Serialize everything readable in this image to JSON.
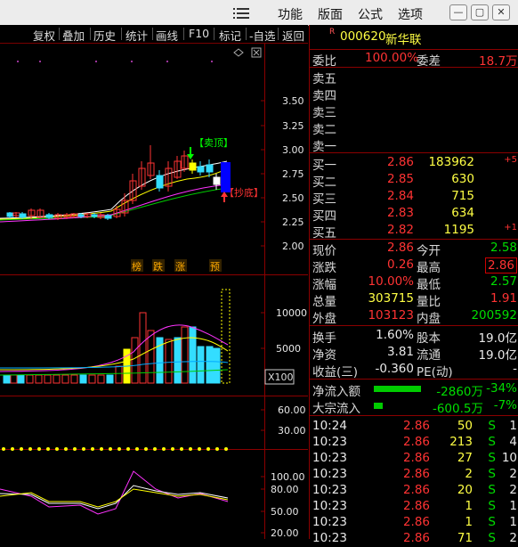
{
  "menu": {
    "items": [
      "功能",
      "版面",
      "公式",
      "选项"
    ],
    "hamburger_icon": "hamburger-menu-icon"
  },
  "window_buttons": {
    "minimize": "—",
    "restore": "▢",
    "close": "✕"
  },
  "toolbar": {
    "items": [
      "复权",
      "叠加",
      "历史",
      "统计",
      "画线",
      "F10",
      "标记",
      "-自选",
      "返回"
    ]
  },
  "main_chart": {
    "y_ticks": [
      "3.50",
      "3.25",
      "3.00",
      "2.75",
      "2.50",
      "2.25",
      "2.00"
    ],
    "annotations": {
      "top": "【卖顶】",
      "bottom": "【抄底】"
    },
    "legend_tags": [
      "榜",
      "跌",
      "涨",
      "预"
    ],
    "colors": {
      "up": "#ff3333",
      "down": "#33ddff",
      "ma1": "#ffffff",
      "ma2": "#ffff00",
      "ma3": "#ff33ff",
      "ma4": "#00cc00"
    }
  },
  "volume_chart": {
    "y_ticks": [
      "10000",
      "5000"
    ],
    "unit": "X100"
  },
  "osc1_chart": {
    "y_ticks": [
      "60.00",
      "30.00"
    ]
  },
  "osc2_chart": {
    "y_ticks": [
      "100.00",
      "80.00",
      "50.00",
      "20.00"
    ]
  },
  "stock": {
    "code": "000620",
    "name": "新华联",
    "badge": "R"
  },
  "weibi": {
    "label": "委比",
    "value": "100.00%",
    "label2": "委差",
    "value2": "18.7万"
  },
  "asks": [
    {
      "label": "卖五",
      "price": "",
      "vol": ""
    },
    {
      "label": "卖四",
      "price": "",
      "vol": ""
    },
    {
      "label": "卖三",
      "price": "",
      "vol": ""
    },
    {
      "label": "卖二",
      "price": "",
      "vol": ""
    },
    {
      "label": "卖一",
      "price": "",
      "vol": ""
    }
  ],
  "bids": [
    {
      "label": "买一",
      "price": "2.86",
      "vol": "183962",
      "chg": "+5"
    },
    {
      "label": "买二",
      "price": "2.85",
      "vol": "630",
      "chg": ""
    },
    {
      "label": "买三",
      "price": "2.84",
      "vol": "715",
      "chg": ""
    },
    {
      "label": "买四",
      "price": "2.83",
      "vol": "634",
      "chg": ""
    },
    {
      "label": "买五",
      "price": "2.82",
      "vol": "1195",
      "chg": "+1"
    }
  ],
  "quote_stats": [
    {
      "l1": "现价",
      "v1": "2.86",
      "l2": "今开",
      "v2": "2.58"
    },
    {
      "l1": "涨跌",
      "v1": "0.26",
      "l2": "最高",
      "v2": "2.86"
    },
    {
      "l1": "涨幅",
      "v1": "10.00%",
      "l2": "最低",
      "v2": "2.57"
    },
    {
      "l1": "总量",
      "v1": "303715",
      "l2": "量比",
      "v2": "1.91"
    },
    {
      "l1": "外盘",
      "v1": "103123",
      "l2": "内盘",
      "v2": "200592"
    }
  ],
  "fundamentals": [
    {
      "l1": "换手",
      "v1": "1.60%",
      "l2": "股本",
      "v2": "19.0亿"
    },
    {
      "l1": "净资",
      "v1": "3.81",
      "l2": "流通",
      "v2": "19.0亿"
    },
    {
      "l1": "收益(三)",
      "v1": "-0.360",
      "l2": "PE(动)",
      "v2": "-"
    }
  ],
  "flows": [
    {
      "label": "净流入额",
      "value": "-2860万",
      "pct": "-34%",
      "bar_fraction": 0.95
    },
    {
      "label": "大宗流入",
      "value": "-600.5万",
      "pct": "-7%",
      "bar_fraction": 0.18
    }
  ],
  "ticks": [
    {
      "time": "10:24",
      "price": "2.86",
      "vol": "50",
      "bs": "S",
      "n": "1"
    },
    {
      "time": "10:23",
      "price": "2.86",
      "vol": "213",
      "bs": "S",
      "n": "4"
    },
    {
      "time": "10:23",
      "price": "2.86",
      "vol": "27",
      "bs": "S",
      "n": "10"
    },
    {
      "time": "10:23",
      "price": "2.86",
      "vol": "2",
      "bs": "S",
      "n": "2"
    },
    {
      "time": "10:23",
      "price": "2.86",
      "vol": "20",
      "bs": "S",
      "n": "2"
    },
    {
      "time": "10:23",
      "price": "2.86",
      "vol": "1",
      "bs": "S",
      "n": "1"
    },
    {
      "time": "10:23",
      "price": "2.86",
      "vol": "1",
      "bs": "S",
      "n": "1"
    },
    {
      "time": "10:23",
      "price": "2.86",
      "vol": "71",
      "bs": "S",
      "n": "2"
    }
  ]
}
